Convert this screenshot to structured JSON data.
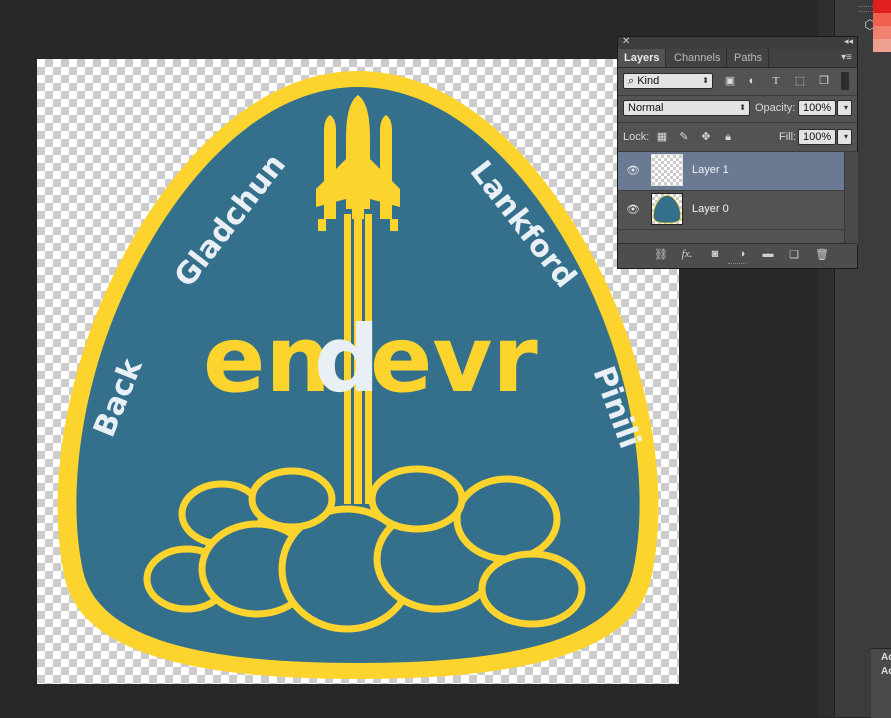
{
  "colors": {
    "patch_blue": "#346f8c",
    "patch_yellow": "#fdd42e",
    "patch_light": "#e8f0f5",
    "selected_layer": "#6a7a92"
  },
  "artwork": {
    "brand_part1": "en",
    "brand_part2": "d",
    "brand_part3": "evr",
    "name_left_lower": "Back",
    "name_left_upper": "Gladchun",
    "name_right_upper": "Lankford",
    "name_right_lower": "Pinili"
  },
  "layers_panel": {
    "tabs": [
      {
        "label": "Layers",
        "active": true
      },
      {
        "label": "Channels",
        "active": false
      },
      {
        "label": "Paths",
        "active": false
      }
    ],
    "filter_kind": "Kind",
    "blend_mode": "Normal",
    "opacity_label": "Opacity:",
    "opacity_value": "100%",
    "lock_label": "Lock:",
    "fill_label": "Fill:",
    "fill_value": "100%",
    "layers": [
      {
        "name": "Layer 1",
        "visible": true,
        "selected": true
      },
      {
        "name": "Layer 0",
        "visible": true,
        "selected": false
      }
    ],
    "filter_icons": [
      "image-filter-icon",
      "adjustment-filter-icon",
      "type-filter-icon",
      "shape-filter-icon",
      "smart-object-filter-icon"
    ],
    "lock_icons": [
      "lock-transparent-icon",
      "lock-paint-icon",
      "lock-move-icon",
      "lock-all-icon"
    ],
    "footer_icons": [
      "link-layers-icon",
      "fx-icon",
      "add-mask-icon",
      "adjustment-layer-icon",
      "new-group-icon",
      "new-layer-icon",
      "delete-layer-icon"
    ]
  },
  "dock": {
    "bottom_labels": [
      "Ad",
      "Ad"
    ],
    "swatch_colors": [
      "#e02020",
      "#f06050",
      "#f08070",
      "#f0a090"
    ]
  }
}
